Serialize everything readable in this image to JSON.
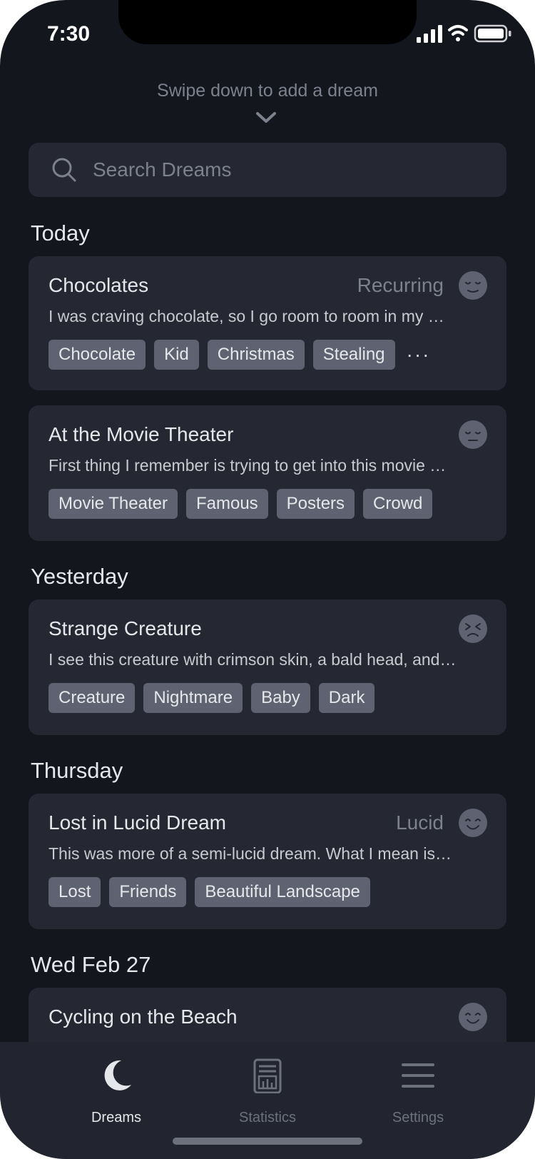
{
  "status_bar": {
    "time": "7:30"
  },
  "swipe_hint": "Swipe down to add a dream",
  "search": {
    "placeholder": "Search Dreams"
  },
  "sections": [
    {
      "heading": "Today",
      "dreams": [
        {
          "title": "Chocolates",
          "type": "Recurring",
          "mood": "content-face-icon",
          "excerpt": "I was craving chocolate, so I go room to room in my …",
          "tags": [
            "Chocolate",
            "Kid",
            "Christmas",
            "Stealing"
          ],
          "more": "···"
        },
        {
          "title": "At the Movie Theater",
          "type": "",
          "mood": "neutral-face-icon",
          "excerpt": "First thing I remember is trying to get into this movie …",
          "tags": [
            "Movie Theater",
            "Famous",
            "Posters",
            "Crowd"
          ]
        }
      ]
    },
    {
      "heading": "Yesterday",
      "dreams": [
        {
          "title": "Strange Creature",
          "type": "",
          "mood": "distressed-face-icon",
          "excerpt": "I see this creature with crimson skin, a bald head, and…",
          "tags": [
            "Creature",
            "Nightmare",
            "Baby",
            "Dark"
          ]
        }
      ]
    },
    {
      "heading": "Thursday",
      "dreams": [
        {
          "title": "Lost in Lucid Dream",
          "type": "Lucid",
          "mood": "smiling-face-icon",
          "excerpt": "This was more of a semi-lucid dream. What I mean is…",
          "tags": [
            "Lost",
            "Friends",
            "Beautiful Landscape"
          ]
        }
      ]
    },
    {
      "heading": "Wed Feb 27",
      "dreams": [
        {
          "title": "Cycling on the Beach",
          "type": "",
          "mood": "smiling-face-icon"
        }
      ]
    }
  ],
  "tab_bar": {
    "tabs": [
      {
        "label": "Dreams",
        "icon": "moon-icon",
        "active": true
      },
      {
        "label": "Statistics",
        "icon": "statistics-icon",
        "active": false
      },
      {
        "label": "Settings",
        "icon": "menu-icon",
        "active": false
      }
    ]
  },
  "colors": {
    "background": "#14161e",
    "card": "#252833",
    "tag": "#5f6270",
    "muted_text": "#7d818d",
    "primary_text": "#e6e7eb",
    "mood_icon": "#5f6270",
    "active_tab": "#e6e7eb",
    "inactive_tab": "#6d717d"
  }
}
